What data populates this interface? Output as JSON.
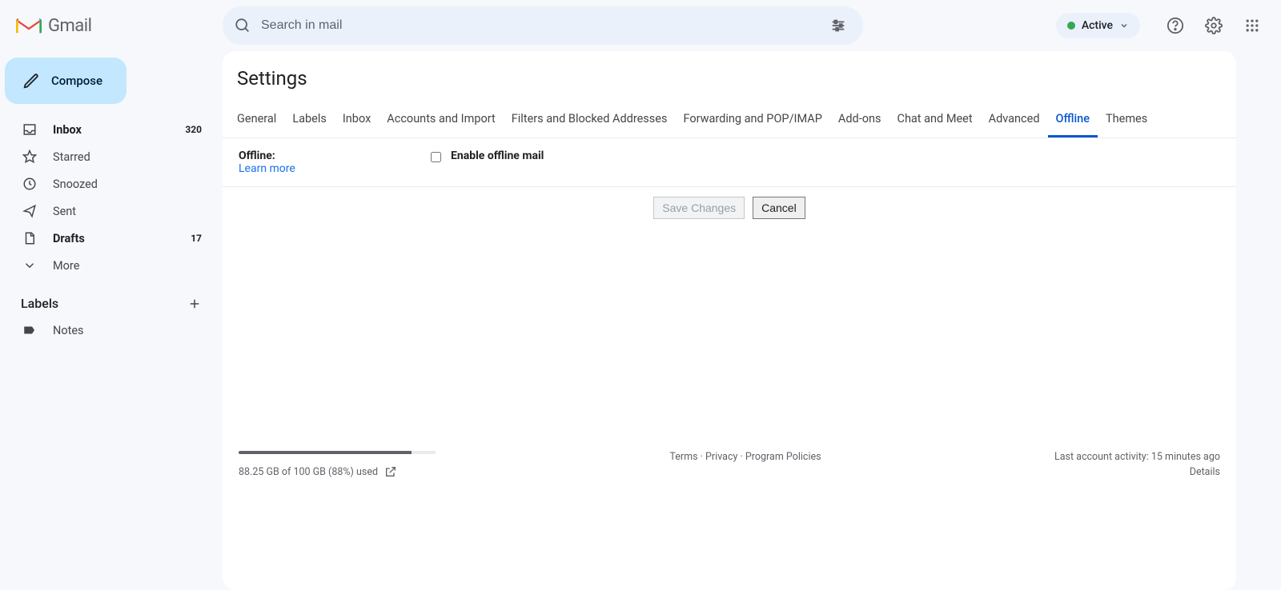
{
  "header": {
    "product_name": "Gmail",
    "search_placeholder": "Search in mail",
    "status_label": "Active"
  },
  "compose": {
    "label": "Compose"
  },
  "nav": {
    "inbox": {
      "label": "Inbox",
      "count": "320"
    },
    "starred": {
      "label": "Starred"
    },
    "snoozed": {
      "label": "Snoozed"
    },
    "sent": {
      "label": "Sent"
    },
    "drafts": {
      "label": "Drafts",
      "count": "17"
    },
    "more": {
      "label": "More"
    }
  },
  "labels_section": {
    "title": "Labels",
    "items": {
      "notes": "Notes"
    }
  },
  "settings": {
    "title": "Settings",
    "tabs": {
      "general": "General",
      "labels": "Labels",
      "inbox": "Inbox",
      "accounts": "Accounts and Import",
      "filters": "Filters and Blocked Addresses",
      "forwarding": "Forwarding and POP/IMAP",
      "addons": "Add-ons",
      "chat": "Chat and Meet",
      "advanced": "Advanced",
      "offline": "Offline",
      "themes": "Themes"
    },
    "offline": {
      "label": "Offline:",
      "learn_more": "Learn more",
      "checkbox_label": "Enable offline mail",
      "checked": false
    },
    "buttons": {
      "save": "Save Changes",
      "cancel": "Cancel"
    }
  },
  "footer": {
    "storage_percent": 88,
    "storage_text": "88.25 GB of 100 GB (88%) used",
    "links": {
      "terms": "Terms",
      "privacy": "Privacy",
      "policies": "Program Policies"
    },
    "sep": " · ",
    "activity": "Last account activity: 15 minutes ago",
    "details": "Details"
  }
}
